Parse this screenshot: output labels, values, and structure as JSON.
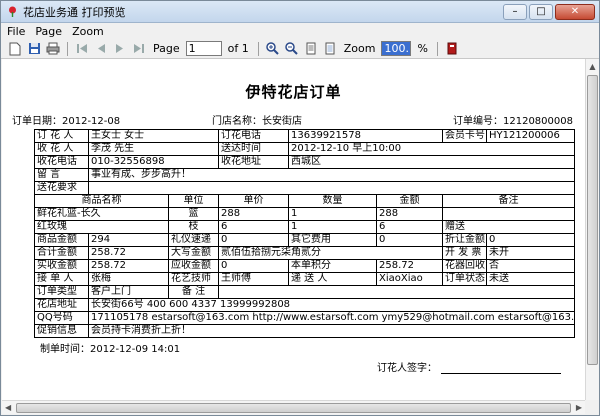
{
  "window": {
    "title": "花店业务通 打印预览",
    "min": "–",
    "max": "□",
    "close": "✕"
  },
  "menu": [
    "File",
    "Page",
    "Zoom"
  ],
  "toolbar": {
    "page_label": "Page",
    "page_value": "1",
    "of_label": "of 1",
    "zoom_label": "Zoom",
    "zoom_value": "100.0",
    "percent": "%"
  },
  "doc": {
    "title": "伊特花店订单",
    "order_date_label": "订单日期：",
    "order_date": "2012-12-08",
    "store_label": "门店名称：",
    "store": "长安街店",
    "order_no_label": "订单编号：",
    "order_no": "12120800008",
    "buyer_label": "订 花 人",
    "buyer": "王女士  女士",
    "buyer_phone_label": "订花电话",
    "buyer_phone": "13639921578",
    "member_label": "会员卡号",
    "member": "HY121200006",
    "receiver_label": "收 花 人",
    "receiver": "李茂  先生",
    "delivery_time_label": "送达时间",
    "delivery_time": "2012-12-10  早上10:00",
    "recv_phone_label": "收花电话",
    "recv_phone": "010-32556898",
    "recv_addr_label": "收花地址",
    "recv_addr": "西城区",
    "message_label": "留    言",
    "message": "事业有成、步步高升！",
    "delivery_req_label": "送花要求",
    "delivery_req": "",
    "items_header": [
      "商品名称",
      "单位",
      "单价",
      "数量",
      "金额",
      "备注"
    ],
    "items": [
      [
        "鲜花礼篮-长久",
        "篮",
        "288",
        "1",
        "288",
        ""
      ],
      [
        "红玫瑰",
        "枝",
        "6",
        "1",
        "6",
        "赠送"
      ]
    ],
    "goods_amt_label": "商品金额",
    "goods_amt": "294",
    "gift_fee_label": "礼仪速递",
    "gift_fee": "0",
    "other_fee_label": "其它费用",
    "other_fee": "0",
    "discount_label": "折让金额",
    "discount": "0",
    "total_label": "合计金额",
    "total": "258.72",
    "total_cn_label": "大写金额",
    "total_cn": "贰佰伍拾捌元柒角贰分",
    "invoice_label": "开 发 票",
    "invoice": "未开",
    "paid_label": "实收金额",
    "paid": "258.72",
    "due_label": "应收金额",
    "due": "0",
    "points_label": "本单积分",
    "points": "258.72",
    "recycle_label": "花器回收",
    "recycle": "否",
    "taker_label": "接 单 人",
    "taker": "张梅",
    "florist_label": "花艺技师",
    "florist": "王师傅",
    "courier_label": "递 送 人",
    "courier": "XiaoXiao",
    "status_label": "订单状态",
    "status": "未送",
    "type_label": "订单类型",
    "type": "客户上门",
    "remark_label": "备    注",
    "remark": "",
    "shop_addr_label": "花店地址",
    "shop_addr": "长安街66号  400 600 4337  13999992808",
    "qq_label": "QQ号码",
    "qq": "171105178  estarsoft@163.com  http://www.estarsoft.com  ymy529@hotmail.com  estarsoft@163.com",
    "promo_label": "促销信息",
    "promo": "会员持卡消费折上折！",
    "made_time_label": "制单时间：",
    "made_time": "2012-12-09 14:01",
    "sign_label": "订花人签字："
  }
}
